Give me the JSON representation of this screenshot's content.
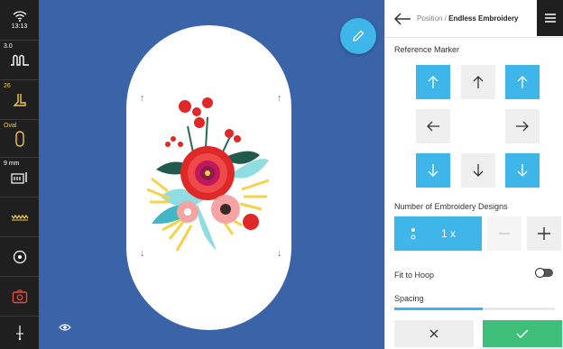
{
  "sidebar": {
    "time": "13:13",
    "stitch_length": "3.0",
    "presser_foot": "26",
    "hoop": "Oval",
    "thread_width": "9 mm"
  },
  "header": {
    "breadcrumb_parent": "Position /",
    "breadcrumb_current": "Endless Embroidery"
  },
  "reference_marker": {
    "title": "Reference Marker",
    "buttons": [
      {
        "icon": "arrow-up-icon",
        "active": true
      },
      {
        "icon": "arrow-up-icon",
        "active": false
      },
      {
        "icon": "arrow-up-icon",
        "active": true
      },
      {
        "icon": "arrow-left-icon",
        "active": false
      },
      {
        "icon": "arrow-right-icon",
        "active": false
      },
      {
        "icon": "arrow-down-icon",
        "active": true
      },
      {
        "icon": "arrow-down-icon",
        "active": false
      },
      {
        "icon": "arrow-down-icon",
        "active": true
      }
    ]
  },
  "designs": {
    "title": "Number of Embroidery Designs",
    "count": "1 x",
    "minus": "−",
    "plus": "+"
  },
  "fit_to_hoop": {
    "label": "Fit to Hoop",
    "enabled": false
  },
  "spacing": {
    "label": "Spacing",
    "level": 0.55
  },
  "colors": {
    "accent": "#3fb6ea",
    "confirm": "#3ec07a",
    "canvas": "#3a63a8",
    "sidebar": "#1f1f1f",
    "marker": "#e24a3b"
  }
}
